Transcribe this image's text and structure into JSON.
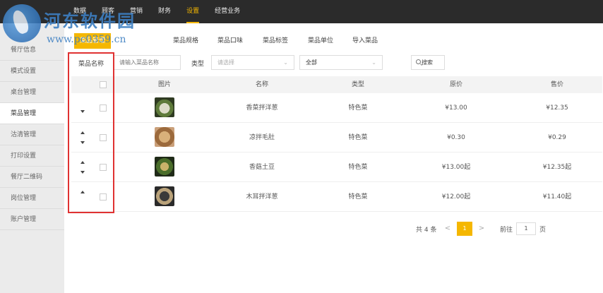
{
  "topnav": [
    {
      "label": "数据",
      "active": false
    },
    {
      "label": "顾客",
      "active": false
    },
    {
      "label": "营销",
      "active": false
    },
    {
      "label": "财务",
      "active": false
    },
    {
      "label": "设置",
      "active": true
    },
    {
      "label": "经营业务",
      "active": false
    }
  ],
  "watermark": {
    "title": "河东软件园",
    "url": "www.pc0359.cn"
  },
  "sidebar": {
    "items": [
      {
        "label": "餐厅信息"
      },
      {
        "label": "模式设置"
      },
      {
        "label": "桌台管理"
      },
      {
        "label": "菜品管理",
        "active": true
      },
      {
        "label": "沽清管理"
      },
      {
        "label": "打印设置"
      },
      {
        "label": "餐厅二维码"
      },
      {
        "label": "岗位管理"
      },
      {
        "label": "账户管理"
      }
    ]
  },
  "subtabs": [
    {
      "label": "菜品管理",
      "active": true
    },
    {
      "label": "菜品规格"
    },
    {
      "label": "菜品口味"
    },
    {
      "label": "菜品标签"
    },
    {
      "label": "菜品单位"
    },
    {
      "label": "导入菜品"
    }
  ],
  "filters": {
    "name_label": "菜品名称",
    "name_placeholder": "请输入菜品名称",
    "type_label": "类型",
    "type_placeholder": "请选择",
    "status_value": "全部",
    "search_button": "搜索"
  },
  "table": {
    "columns": [
      "图片",
      "名称",
      "类型",
      "原价",
      "售价"
    ],
    "rows": [
      {
        "name": "香菜拌洋葱",
        "type": "特色菜",
        "original_price": "¥13.00",
        "sale_price": "¥12.35",
        "up": false,
        "down": true
      },
      {
        "name": "凉拌毛肚",
        "type": "特色菜",
        "original_price": "¥0.30",
        "sale_price": "¥0.29",
        "up": true,
        "down": true
      },
      {
        "name": "香菇土豆",
        "type": "特色菜",
        "original_price": "¥13.00起",
        "sale_price": "¥12.35起",
        "up": true,
        "down": true
      },
      {
        "name": "木耳拌洋葱",
        "type": "特色菜",
        "original_price": "¥12.00起",
        "sale_price": "¥11.40起",
        "up": true,
        "down": false
      }
    ]
  },
  "pagination": {
    "total": "共 4 条",
    "prev": "<",
    "current": "1",
    "next": ">",
    "goto_label": "前往",
    "goto_value": "1",
    "page_suffix": "页"
  },
  "colors": {
    "accent": "#f5b700",
    "topbar": "#2b2b2b",
    "highlight_box": "#e03232"
  }
}
